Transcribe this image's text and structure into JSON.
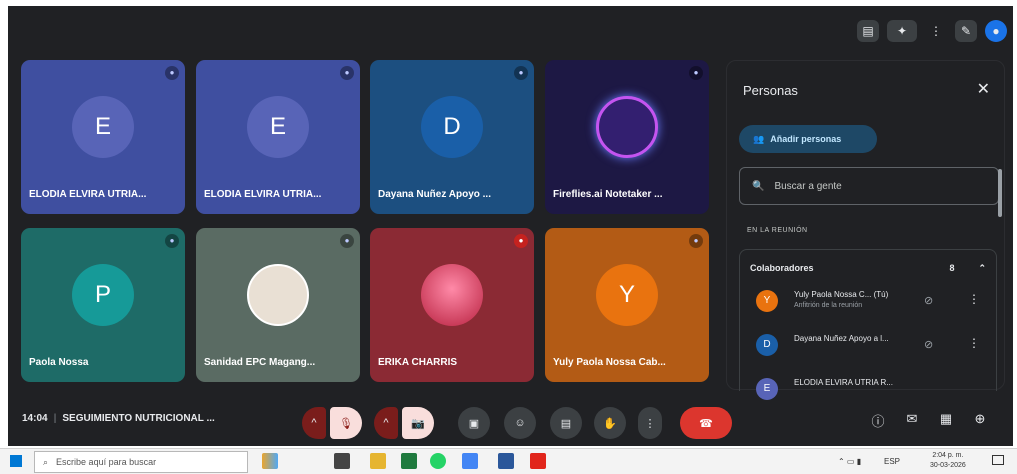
{
  "top_icons": [
    {
      "icon": "presentation-icon"
    },
    {
      "icon": "effects-icon"
    },
    {
      "icon": "more-icon"
    },
    {
      "icon": "wrench-icon"
    },
    {
      "icon": "account-icon"
    }
  ],
  "tiles": [
    {
      "name": "ELODIA ELVIRA UTRIA...",
      "initial": "E",
      "bg": "#3f4fa0",
      "avatar_color": "#5864b7"
    },
    {
      "name": "ELODIA ELVIRA UTRIA...",
      "initial": "E",
      "bg": "#3f4fa0",
      "avatar_color": "#5864b7"
    },
    {
      "name": "Dayana Nuñez Apoyo ...",
      "initial": "D",
      "bg": "#1c4f80",
      "avatar_color": "#1a5fa8"
    },
    {
      "name": "Fireflies.ai Notetaker ...",
      "initial": "",
      "bg": "#1d1844",
      "avatar_color": "#331f70"
    },
    {
      "name": "Paola Nossa",
      "initial": "P",
      "bg": "#1e6b67",
      "avatar_color": "#169a98"
    },
    {
      "name": "Sanidad EPC Magang...",
      "initial": "",
      "bg": "#5a6b63",
      "avatar_color": "#e9e0d4"
    },
    {
      "name": "ERIKA CHARRIS",
      "initial": "",
      "bg": "#8b2a34",
      "avatar_color": "#d8586e"
    },
    {
      "name": "Yuly Paola Nossa Cab...",
      "initial": "Y",
      "bg": "#b35b15",
      "avatar_color": "#e9730f"
    }
  ],
  "panel": {
    "title": "Personas",
    "add_label": "Añadir personas",
    "search_placeholder": "Buscar a gente",
    "section": "EN LA REUNIÓN",
    "group_label": "Colaboradores",
    "group_count": "8",
    "people": [
      {
        "initial": "Y",
        "name": "Yuly Paola Nossa C... (Tú)",
        "sub": "Anfitrión de la reunión",
        "color": "#e9730f"
      },
      {
        "initial": "D",
        "name": "Dayana Nuñez Apoyo a l...",
        "sub": "",
        "color": "#1a5fa8"
      },
      {
        "initial": "E",
        "name": "ELODIA ELVIRA UTRIA R...",
        "sub": "",
        "color": "#5864b7"
      }
    ]
  },
  "bottom": {
    "time": "14:04",
    "meeting": "SEGUIMIENTO NUTRICIONAL ..."
  },
  "controls": [
    {
      "name": "mic-chevron",
      "icon": "^"
    },
    {
      "name": "mic-off",
      "icon": "🎙"
    },
    {
      "name": "cam-chevron",
      "icon": "^"
    },
    {
      "name": "cam-off",
      "icon": "📷"
    },
    {
      "name": "present",
      "icon": "▣"
    },
    {
      "name": "emoji",
      "icon": "☺"
    },
    {
      "name": "captions",
      "icon": "▤"
    },
    {
      "name": "raise-hand",
      "icon": "✋"
    },
    {
      "name": "more",
      "icon": "⋮"
    },
    {
      "name": "leave",
      "icon": "☎"
    }
  ],
  "right_controls": [
    {
      "icon": "info-icon",
      "glyph": "ⓘ"
    },
    {
      "icon": "chat-icon",
      "glyph": "✉"
    },
    {
      "icon": "activities-icon",
      "glyph": "▦"
    },
    {
      "icon": "lock-icon",
      "glyph": "⊕"
    }
  ],
  "taskbar": {
    "search_placeholder": "Escribe aquí para buscar",
    "clock_time": "2:04 p. m.",
    "clock_date": "30-03-2026",
    "lang": "ESP"
  }
}
